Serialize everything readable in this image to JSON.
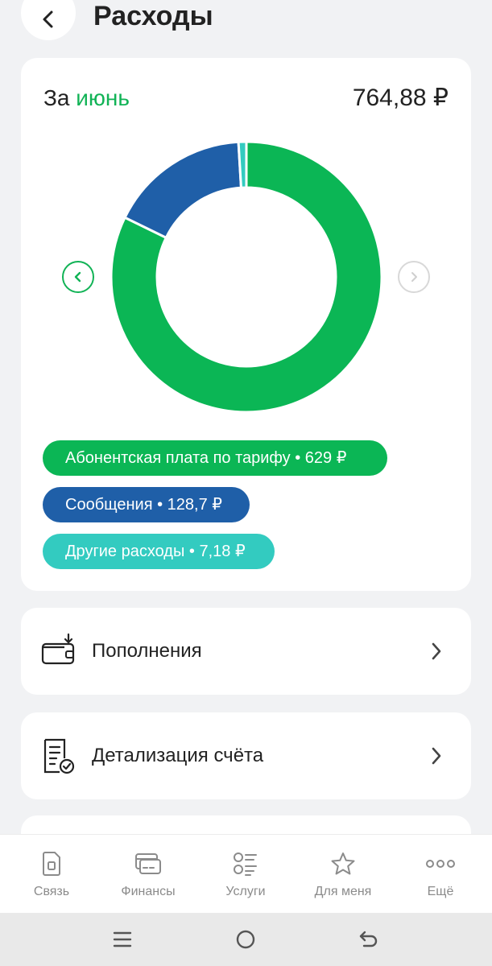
{
  "header": {
    "title": "Расходы"
  },
  "summary": {
    "period_prefix": "За",
    "period_month": "июнь",
    "total": "764,88 ₽",
    "chart_data": {
      "type": "pie",
      "categories": [
        "Абонентская плата по тарифу",
        "Сообщения",
        "Другие расходы"
      ],
      "values": [
        629,
        128.7,
        7.18
      ],
      "colors": [
        "#0bb655",
        "#1f5fa8",
        "#33cbc0"
      ]
    },
    "legend": [
      {
        "label": "Абонентская плата по тарифу • 629 ₽",
        "color": "#0bb655"
      },
      {
        "label": "Сообщения • 128,7 ₽",
        "color": "#1f5fa8"
      },
      {
        "label": "Другие расходы • 7,18 ₽",
        "color": "#33cbc0"
      }
    ]
  },
  "menu": [
    {
      "label": "Пополнения",
      "icon": "wallet-icon"
    },
    {
      "label": "Детализация счёта",
      "icon": "document-check-icon"
    }
  ],
  "tabs": [
    {
      "label": "Связь",
      "icon": "sim-card-icon"
    },
    {
      "label": "Финансы",
      "icon": "cards-icon"
    },
    {
      "label": "Услуги",
      "icon": "services-list-icon"
    },
    {
      "label": "Для меня",
      "icon": "star-icon"
    },
    {
      "label": "Ещё",
      "icon": "more-dots-icon"
    }
  ],
  "colors": {
    "accent": "#11b356",
    "background": "#f1f2f4",
    "card": "#ffffff"
  }
}
